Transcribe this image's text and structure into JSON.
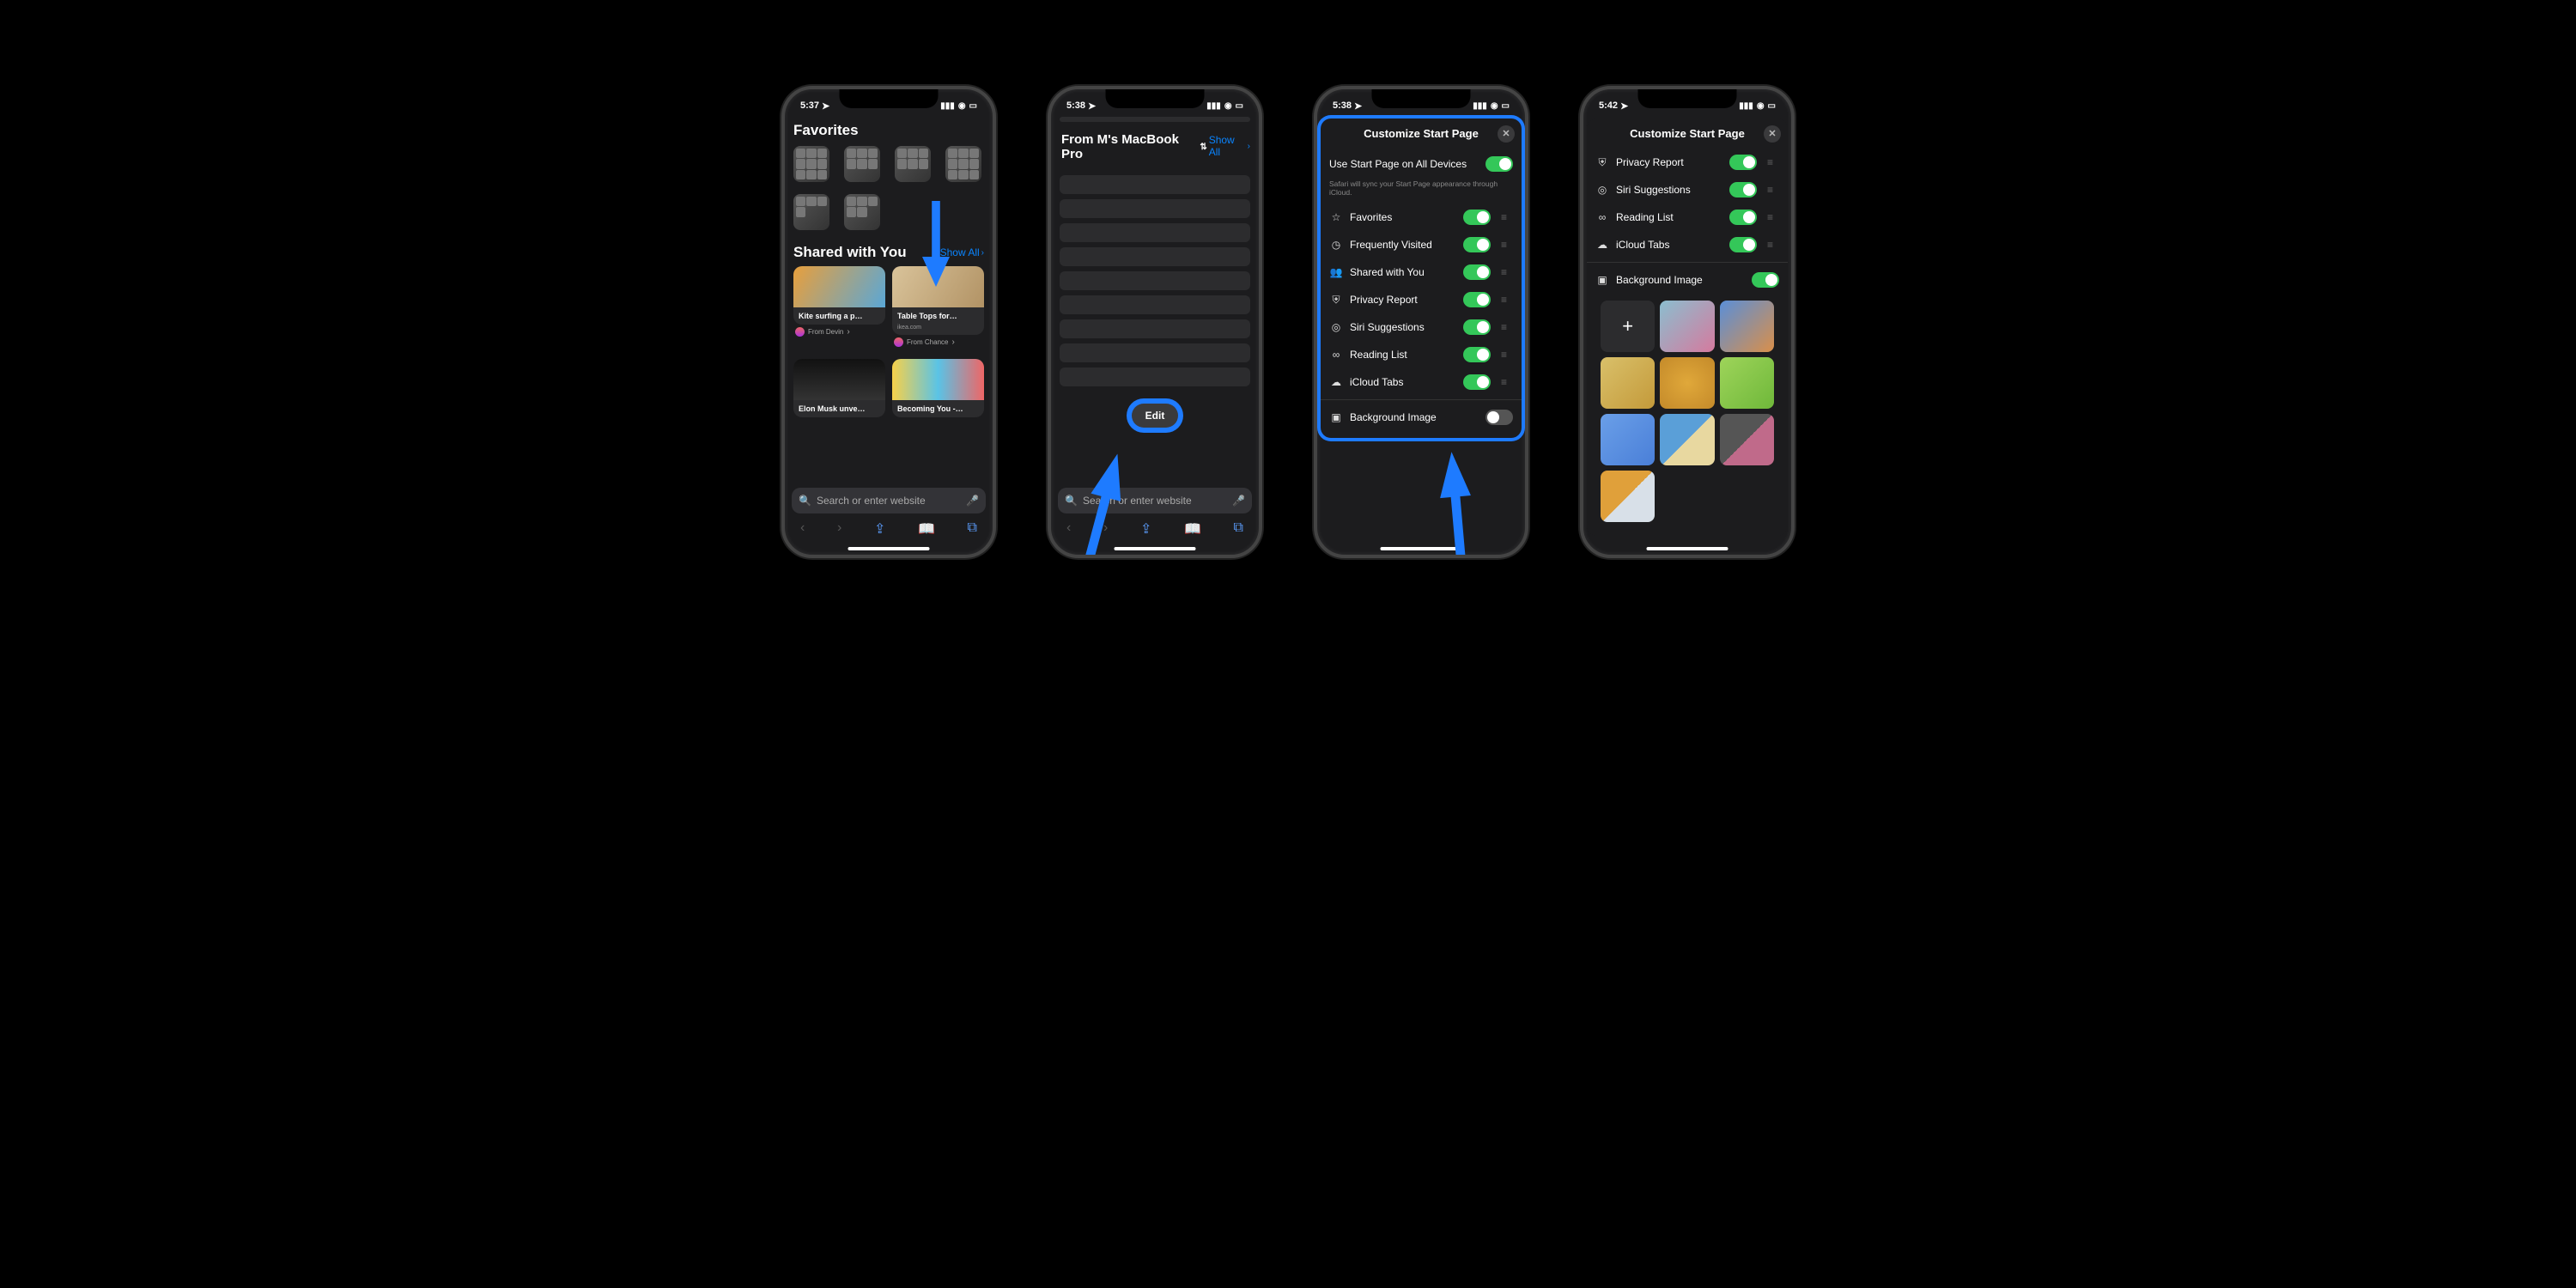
{
  "phone1": {
    "time": "5:37",
    "favorites_title": "Favorites",
    "shared_title": "Shared with You",
    "show_all": "Show All",
    "cards": [
      {
        "title": "Kite surfing a p…",
        "from": "From Devin"
      },
      {
        "title": "Table Tops for…",
        "sub": "ikea.com",
        "from": "From Chance"
      },
      {
        "title": "Elon Musk unve…"
      },
      {
        "title": "Becoming You -…"
      }
    ],
    "search_placeholder": "Search or enter website"
  },
  "phone2": {
    "time": "5:38",
    "handoff_title": "From M's MacBook Pro",
    "show_all": "Show All",
    "edit": "Edit",
    "search_placeholder": "Search or enter website"
  },
  "phone3": {
    "time": "5:38",
    "modal_title": "Customize Start Page",
    "sync_label": "Use Start Page on All Devices",
    "sync_hint": "Safari will sync your Start Page appearance through iCloud.",
    "rows": [
      {
        "icon": "star",
        "label": "Favorites",
        "on": true
      },
      {
        "icon": "clock",
        "label": "Frequently Visited",
        "on": true
      },
      {
        "icon": "people",
        "label": "Shared with You",
        "on": true
      },
      {
        "icon": "shield",
        "label": "Privacy Report",
        "on": true
      },
      {
        "icon": "siri",
        "label": "Siri Suggestions",
        "on": true
      },
      {
        "icon": "glasses",
        "label": "Reading List",
        "on": true
      },
      {
        "icon": "cloud",
        "label": "iCloud Tabs",
        "on": true
      }
    ],
    "bg_label": "Background Image"
  },
  "phone4": {
    "time": "5:42",
    "modal_title": "Customize Start Page",
    "rows": [
      {
        "icon": "shield",
        "label": "Privacy Report",
        "on": true
      },
      {
        "icon": "siri",
        "label": "Siri Suggestions",
        "on": true
      },
      {
        "icon": "glasses",
        "label": "Reading List",
        "on": true
      },
      {
        "icon": "cloud",
        "label": "iCloud Tabs",
        "on": true
      }
    ],
    "bg_label": "Background Image",
    "bg_tiles": [
      "add",
      "linear-gradient(135deg,#8bbecf,#d57a9e)",
      "linear-gradient(135deg,#5a8fd8,#d98f4a)",
      "linear-gradient(135deg,#d9c06a,#c49a3a)",
      "radial-gradient(#e0a83a,#c48a2a)",
      "linear-gradient(135deg,#9ed45a,#6fb83a)",
      "linear-gradient(135deg,#6a9fe8,#4a7fd8)",
      "linear-gradient(135deg,#5a9fd8 50%,#e8d8a0 50%)",
      "linear-gradient(135deg,#555 50%,#c06a8a 50%)",
      "linear-gradient(135deg,#e0a03a 50%,#d8e0e8 50%)"
    ]
  }
}
